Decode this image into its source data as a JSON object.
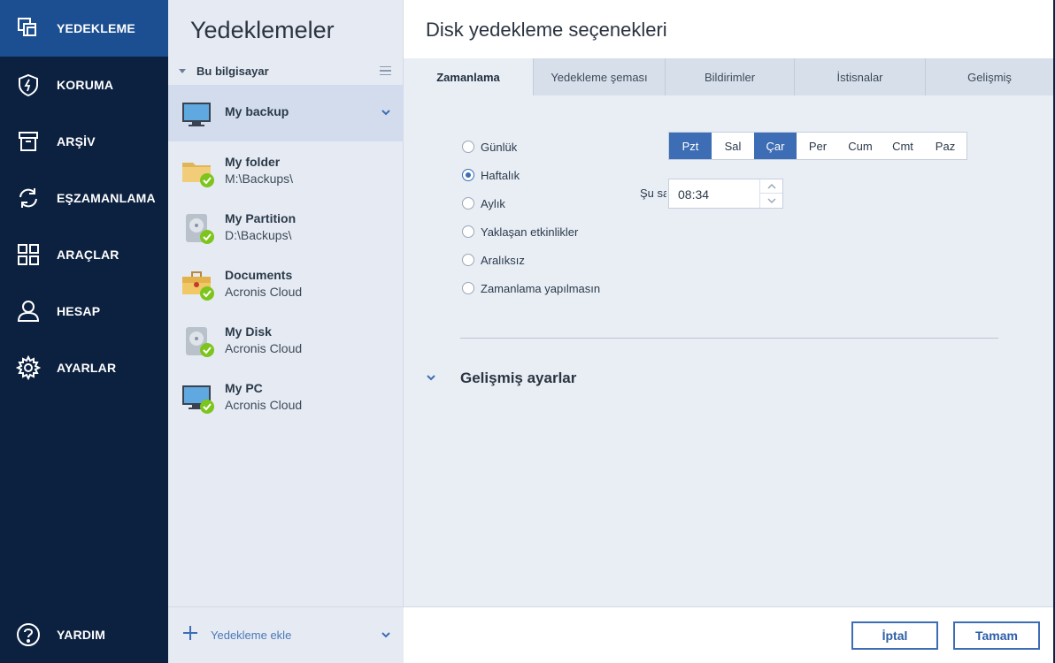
{
  "nav": {
    "items": [
      {
        "label": "YEDEKLEME",
        "icon": "copy-backup-icon",
        "active": true
      },
      {
        "label": "KORUMA",
        "icon": "shield-icon"
      },
      {
        "label": "ARŞİV",
        "icon": "archive-box-icon"
      },
      {
        "label": "EŞZAMANLAMA",
        "icon": "sync-icon"
      },
      {
        "label": "ARAÇLAR",
        "icon": "grid-tools-icon"
      },
      {
        "label": "HESAP",
        "icon": "user-icon"
      },
      {
        "label": "AYARLAR",
        "icon": "gear-icon"
      }
    ],
    "help": {
      "label": "YARDIM",
      "icon": "question-icon"
    }
  },
  "list": {
    "title": "Yedeklemeler",
    "group_label": "Bu bilgisayar",
    "items": [
      {
        "name": "My backup",
        "sub": "",
        "icon": "monitor-icon",
        "selected": true
      },
      {
        "name": "My folder",
        "sub": "M:\\Backups\\",
        "icon": "folder-icon"
      },
      {
        "name": "My Partition",
        "sub": "D:\\Backups\\",
        "icon": "hard-drive-icon"
      },
      {
        "name": "Documents",
        "sub": "Acronis Cloud",
        "icon": "briefcase-icon"
      },
      {
        "name": "My Disk",
        "sub": "Acronis Cloud",
        "icon": "hard-drive-icon"
      },
      {
        "name": "My PC",
        "sub": "Acronis Cloud",
        "icon": "monitor-icon"
      }
    ],
    "add_label": "Yedekleme ekle"
  },
  "panel": {
    "title": "Disk yedekleme seçenekleri",
    "tabs": [
      "Zamanlama",
      "Yedekleme şeması",
      "Bildirimler",
      "İstisnalar",
      "Gelişmiş"
    ],
    "schedule_options": [
      "Günlük",
      "Haftalık",
      "Aylık",
      "Yaklaşan etkinlikler",
      "Aralıksız",
      "Zamanlama yapılmasın"
    ],
    "selected_option": "Haftalık",
    "days": [
      "Pzt",
      "Sal",
      "Çar",
      "Per",
      "Cum",
      "Cmt",
      "Paz"
    ],
    "selected_days": [
      "Pzt",
      "Çar"
    ],
    "time_label": "Şu saatte:",
    "time_value": "08:34",
    "advanced_label": "Gelişmiş ayarlar",
    "cancel_label": "İptal",
    "ok_label": "Tamam"
  },
  "colors": {
    "nav_bg": "#0c2140",
    "nav_active": "#1c4f91",
    "accent": "#3d6db4",
    "check_green": "#7dc51d"
  }
}
